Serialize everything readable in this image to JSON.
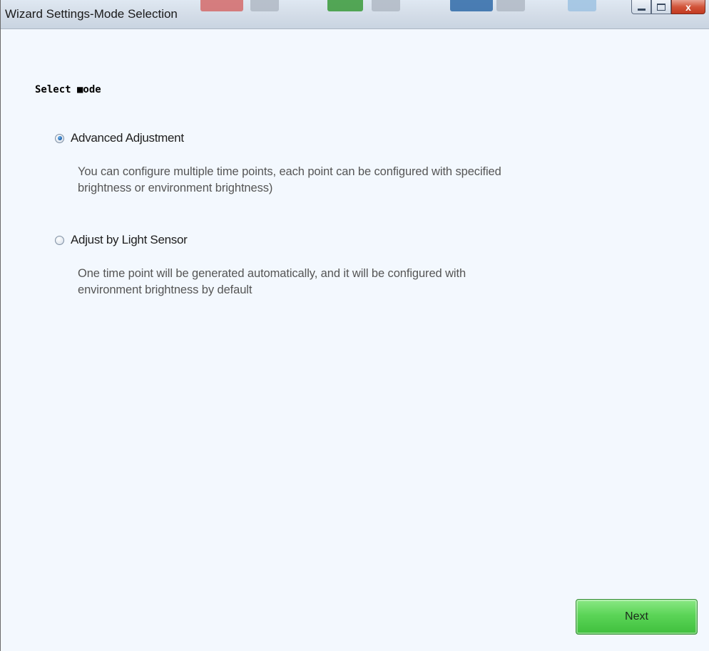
{
  "window": {
    "title": "Wizard Settings-Mode Selection",
    "close_glyph": "x"
  },
  "section": {
    "title": "Select ■ode"
  },
  "options": [
    {
      "label": "Advanced Adjustment",
      "checked": true,
      "description_line1": "You can configure multiple time points, each point can be configured with specified",
      "description_line2": "brightness or environment brightness)"
    },
    {
      "label": "Adjust by Light Sensor",
      "checked": false,
      "description_line1": "One time point will be generated automatically, and it will be configured with",
      "description_line2": "environment brightness by default"
    }
  ],
  "footer": {
    "next_label": "Next"
  },
  "colors": {
    "content_background": "#f3f8fe",
    "next_button": "#5bd457",
    "close_button": "#d2553b"
  },
  "icons": [
    "minimize-icon",
    "maximize-icon",
    "close-icon",
    "radio-selected-icon",
    "radio-unselected-icon"
  ]
}
